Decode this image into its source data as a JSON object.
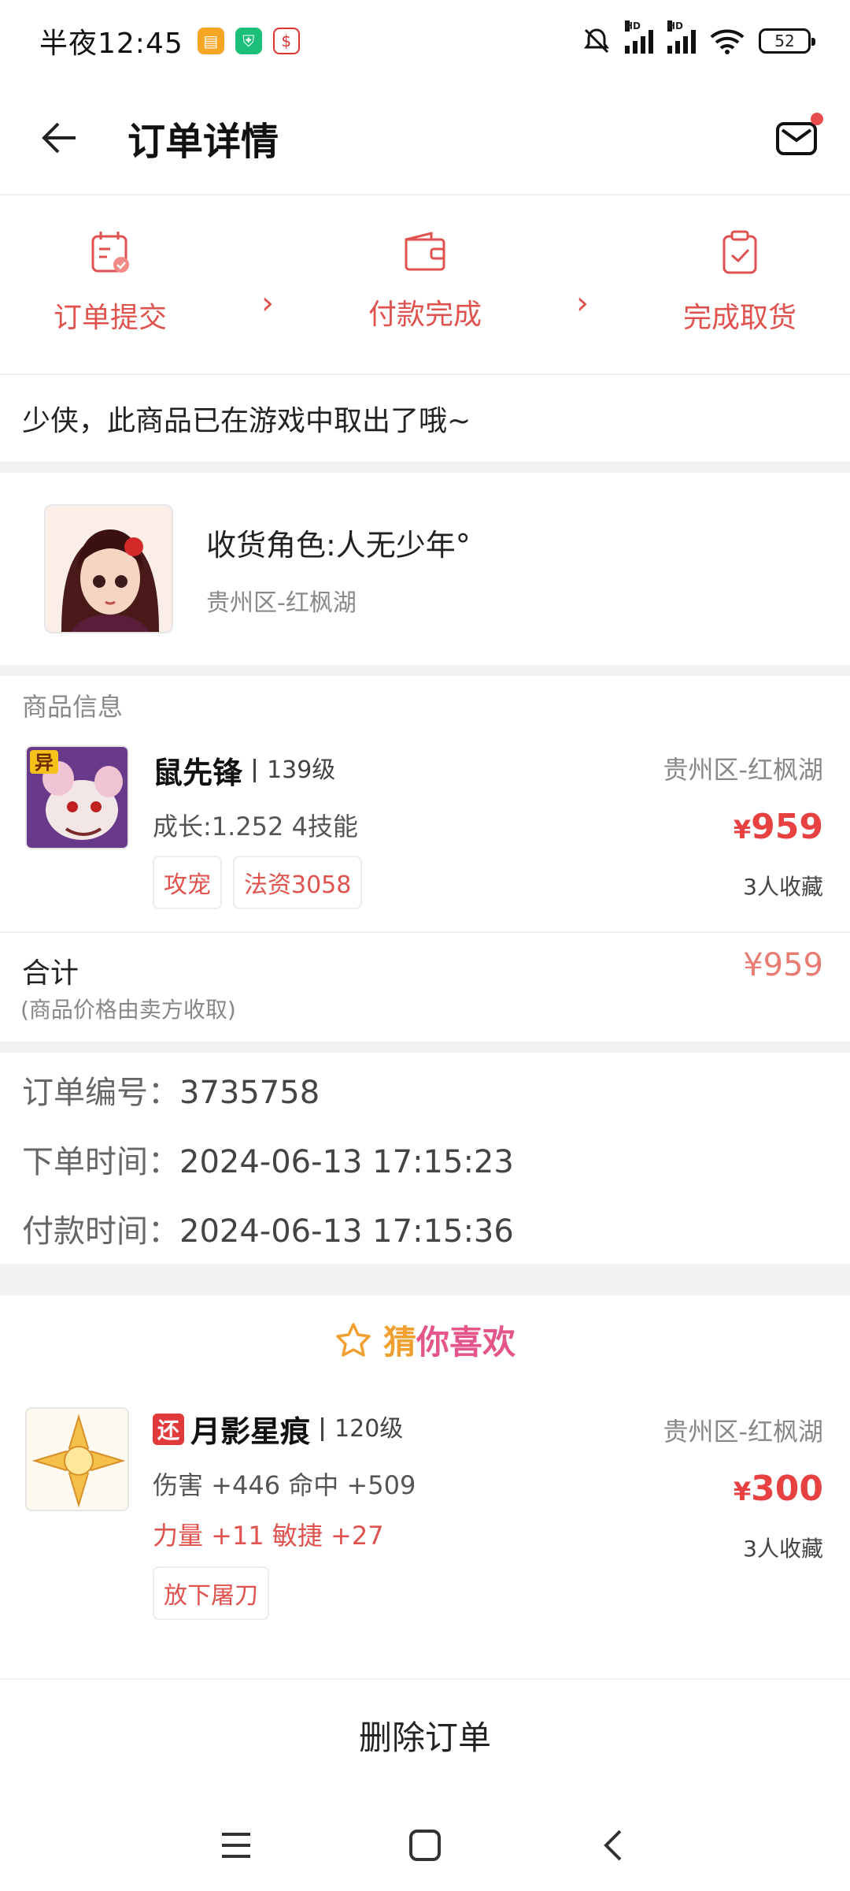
{
  "status": {
    "time": "半夜12:45",
    "battery": "52",
    "hd": "HD"
  },
  "header": {
    "title": "订单详情"
  },
  "steps": [
    {
      "label": "订单提交"
    },
    {
      "label": "付款完成"
    },
    {
      "label": "完成取货"
    }
  ],
  "notice": "少侠，此商品已在游戏中取出了哦~",
  "receiver": {
    "name": "收货角色:人无少年°",
    "server": "贵州区-红枫湖"
  },
  "product_section": {
    "title": "商品信息"
  },
  "product": {
    "badge": "异",
    "name": "鼠先锋",
    "level": "139级",
    "attr": "成长:1.252 4技能",
    "tags": [
      "攻宠",
      "法资3058"
    ],
    "server": "贵州区-红枫湖",
    "currency": "¥",
    "price": "959",
    "favorites": "3人收藏"
  },
  "total": {
    "label": "合计",
    "note": "(商品价格由卖方收取)",
    "amount": "¥959"
  },
  "order_meta": {
    "number_label": "订单编号：",
    "number": "3735758",
    "created_label": "下单时间：",
    "created": "2024-06-13 17:15:23",
    "paid_label": "付款时间：",
    "paid": "2024-06-13 17:15:36"
  },
  "guess": {
    "title_part1": "猜",
    "title_part2": "你喜欢",
    "items": [
      {
        "badge": "还",
        "name": "月影星痕",
        "level": "120级",
        "attr1": "伤害 +446 命中 +509",
        "attr2": "力量 +11 敏捷 +27",
        "tags": [
          "放下屠刀"
        ],
        "server": "贵州区-红枫湖",
        "currency": "¥",
        "price": "300",
        "favorites": "3人收藏"
      }
    ]
  },
  "actions": {
    "delete": "删除订单"
  },
  "colors": {
    "accent": "#e0524d",
    "price": "#e84141"
  }
}
